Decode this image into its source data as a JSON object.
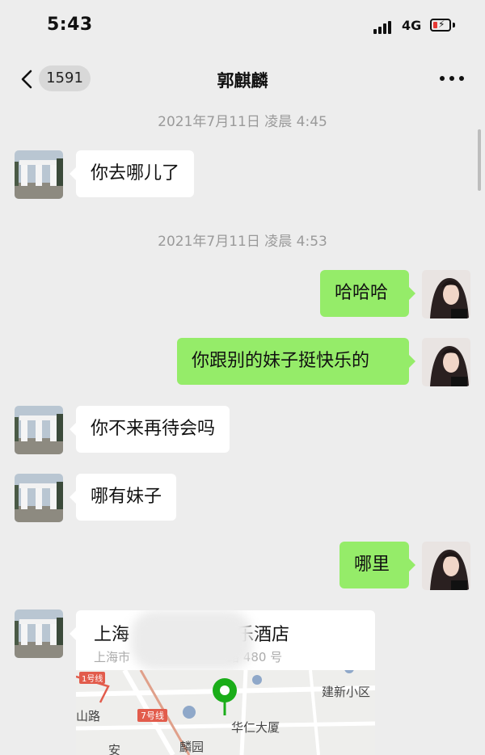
{
  "status_bar": {
    "time": "5:43",
    "network": "4G"
  },
  "nav": {
    "unread_count": "1591",
    "title": "郭麒麟"
  },
  "colors": {
    "sent_bubble": "#95ec69",
    "received_bubble": "#ffffff",
    "background": "#ededed"
  },
  "timestamps": [
    "2021年7月11日 凌晨 4:45",
    "2021年7月11日 凌晨 4:53"
  ],
  "messages": [
    {
      "sender": "other",
      "text": "你去哪儿了"
    },
    {
      "sender": "me",
      "text": "哈哈哈"
    },
    {
      "sender": "me",
      "text": "你跟别的妹子挺快乐的"
    },
    {
      "sender": "other",
      "text": "你不来再待会吗"
    },
    {
      "sender": "other",
      "text": "哪有妹子"
    },
    {
      "sender": "me",
      "text": "哪里"
    }
  ],
  "location": {
    "name_prefix": "上海",
    "name_suffix": "乐酒店",
    "address_prefix": "上海市",
    "address_suffix": "路 480 号",
    "map_labels": [
      "建新小区",
      "山路",
      "7号线",
      "华仁大厦",
      "麟园",
      "1号线",
      "安"
    ]
  }
}
